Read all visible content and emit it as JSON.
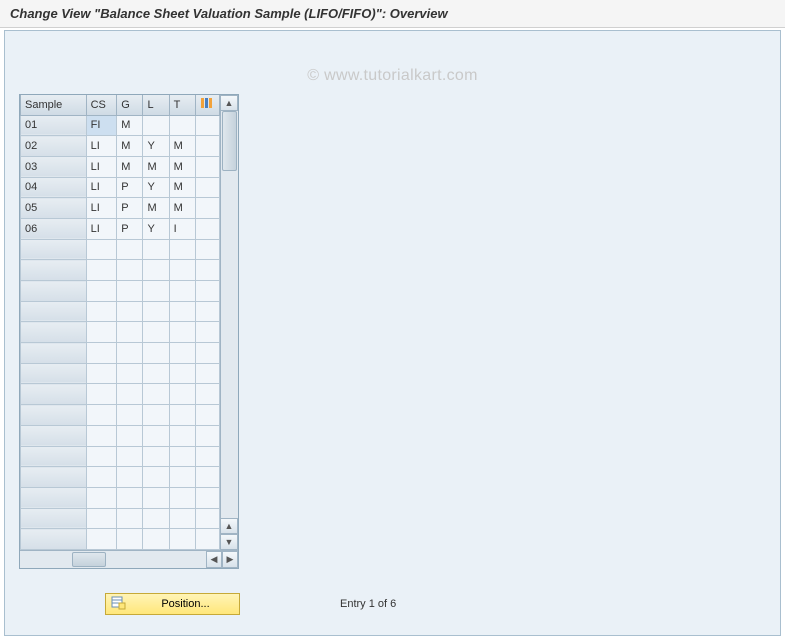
{
  "title": "Change View \"Balance Sheet Valuation Sample (LIFO/FIFO)\": Overview",
  "watermark": "© www.tutorialkart.com",
  "grid": {
    "headers": {
      "sample": "Sample",
      "cs": "CS",
      "g": "G",
      "l": "L",
      "t": "T"
    },
    "rows": [
      {
        "sample": "01",
        "cs": "FI",
        "g": "M",
        "l": "",
        "t": ""
      },
      {
        "sample": "02",
        "cs": "LI",
        "g": "M",
        "l": "Y",
        "t": "M"
      },
      {
        "sample": "03",
        "cs": "LI",
        "g": "M",
        "l": "M",
        "t": "M"
      },
      {
        "sample": "04",
        "cs": "LI",
        "g": "P",
        "l": "Y",
        "t": "M"
      },
      {
        "sample": "05",
        "cs": "LI",
        "g": "P",
        "l": "M",
        "t": "M"
      },
      {
        "sample": "06",
        "cs": "LI",
        "g": "P",
        "l": "Y",
        "t": "I"
      }
    ],
    "blank_row_count": 15
  },
  "footer": {
    "position_label": "Position...",
    "entry_text": "Entry 1 of 6"
  }
}
